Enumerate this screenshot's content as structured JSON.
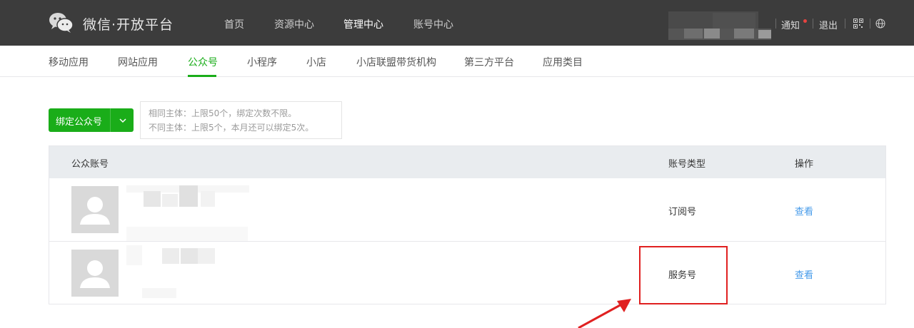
{
  "header": {
    "brand": "微信·开放平台",
    "nav": [
      {
        "label": "首页",
        "active": false
      },
      {
        "label": "资源中心",
        "active": false
      },
      {
        "label": "管理中心",
        "active": true
      },
      {
        "label": "账号中心",
        "active": false
      }
    ],
    "notice": "通知",
    "logout": "退出"
  },
  "subnav": {
    "items": [
      {
        "label": "移动应用",
        "active": false
      },
      {
        "label": "网站应用",
        "active": false
      },
      {
        "label": "公众号",
        "active": true
      },
      {
        "label": "小程序",
        "active": false
      },
      {
        "label": "小店",
        "active": false
      },
      {
        "label": "小店联盟带货机构",
        "active": false
      },
      {
        "label": "第三方平台",
        "active": false
      },
      {
        "label": "应用类目",
        "active": false
      }
    ]
  },
  "toolbar": {
    "bind_button": "绑定公众号",
    "limit_same": "相同主体：上限50个，绑定次数不限。",
    "limit_diff": "不同主体：上限5个，本月还可以绑定5次。"
  },
  "table": {
    "headers": {
      "account": "公众账号",
      "type": "账号类型",
      "action": "操作"
    },
    "rows": [
      {
        "type": "订阅号",
        "action": "查看"
      },
      {
        "type": "服务号",
        "action": "查看"
      }
    ]
  },
  "colors": {
    "header_bg": "#3c3c3c",
    "accent_green": "#1aad19",
    "link_blue": "#459ae9",
    "annotation_red": "#e02020"
  }
}
